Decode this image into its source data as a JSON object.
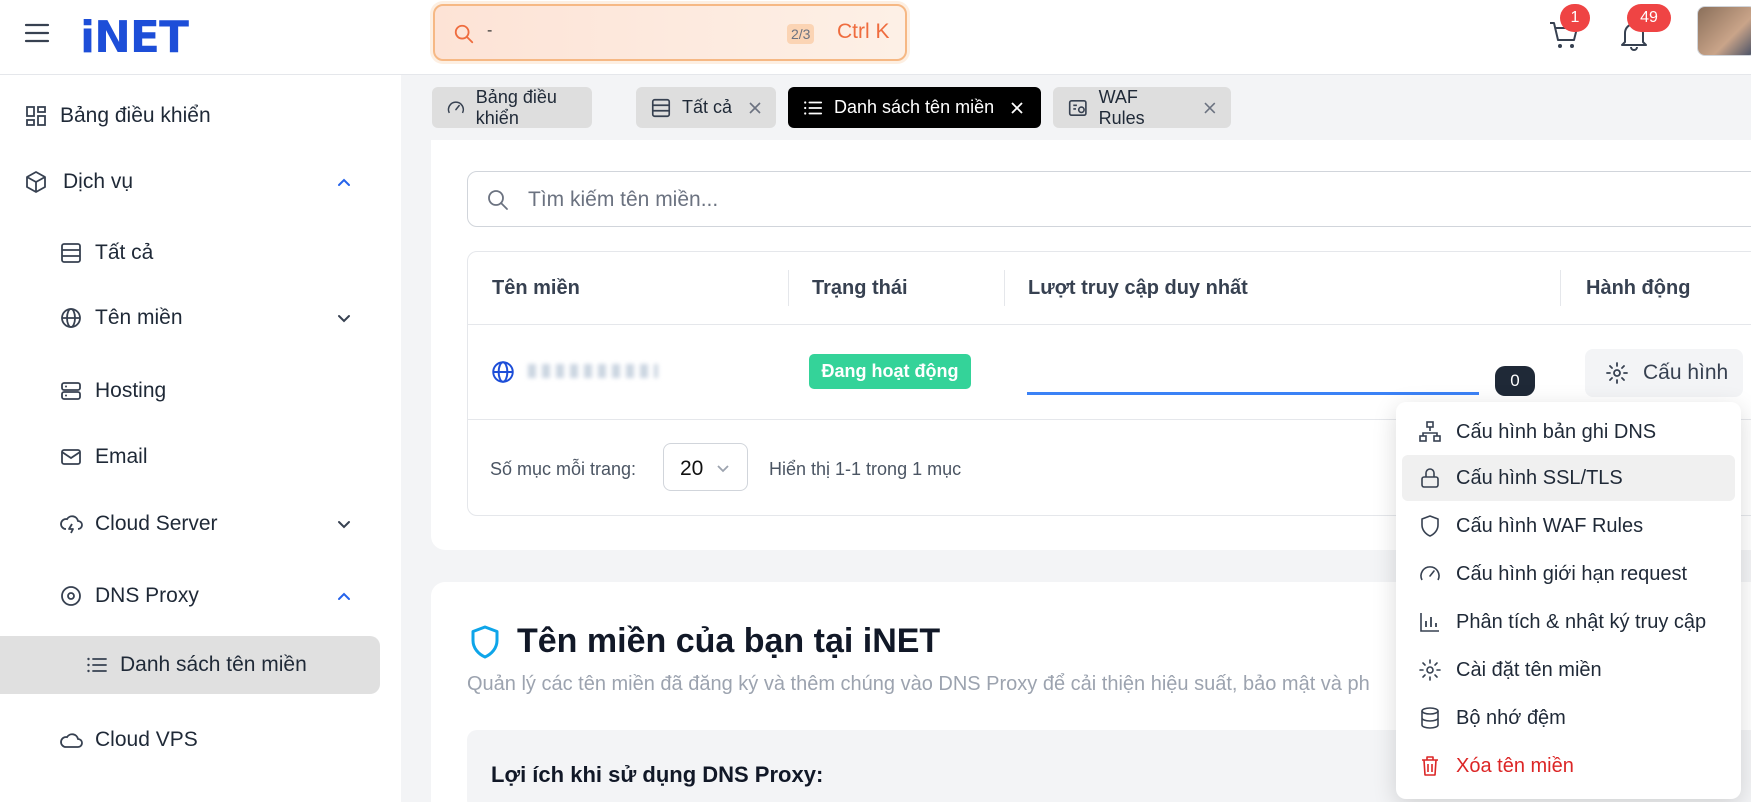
{
  "header": {
    "logo": "iNET",
    "search": {
      "counter": "2/3",
      "shortcut": "Ctrl K"
    },
    "cart_count": "1",
    "notif_count": "49"
  },
  "sidebar": {
    "items": [
      {
        "label": "Bảng điều khiển"
      },
      {
        "label": "Dịch vụ"
      },
      {
        "label": "Tất cả"
      },
      {
        "label": "Tên miền"
      },
      {
        "label": "Hosting"
      },
      {
        "label": "Email"
      },
      {
        "label": "Cloud Server"
      },
      {
        "label": "DNS Proxy"
      },
      {
        "label": "Danh sách tên miền"
      },
      {
        "label": "Cloud VPS"
      }
    ]
  },
  "tabs": [
    {
      "label": "Bảng điều khiển"
    },
    {
      "label": "Tất cả"
    },
    {
      "label": "Danh sách tên miền"
    },
    {
      "label": "WAF Rules"
    }
  ],
  "main": {
    "search_placeholder": "Tìm kiếm tên miền...",
    "columns": [
      "Tên miền",
      "Trạng thái",
      "Lượt truy cập duy nhất",
      "Hành động"
    ],
    "row": {
      "status": "Đang hoạt động",
      "visits": "0",
      "action": "Cấu hình"
    },
    "pagination": {
      "label": "Số mục mỗi trang:",
      "per_page": "20",
      "info": "Hiển thị 1-1 trong 1 mục"
    },
    "section": {
      "title": "Tên miền của bạn tại iNET",
      "subtitle": "Quản lý các tên miền đã đăng ký và thêm chúng vào DNS Proxy để cải thiện hiệu suất, bảo mật và ph",
      "benefit_title": "Lợi ích khi sử dụng DNS Proxy:"
    }
  },
  "menu": {
    "items": [
      {
        "label": "Cấu hình bản ghi DNS",
        "icon": "sitemap-icon"
      },
      {
        "label": "Cấu hình SSL/TLS",
        "icon": "lock-icon"
      },
      {
        "label": "Cấu hình WAF Rules",
        "icon": "shield-icon"
      },
      {
        "label": "Cấu hình giới hạn request",
        "icon": "gauge-icon"
      },
      {
        "label": "Phân tích & nhật ký truy cập",
        "icon": "bar-chart-icon"
      },
      {
        "label": "Cài đặt tên miền",
        "icon": "gear-icon"
      },
      {
        "label": "Bộ nhớ đệm",
        "icon": "database-icon"
      },
      {
        "label": "Xóa tên miền",
        "icon": "trash-icon"
      }
    ]
  },
  "colors": {
    "brand": "#1d4ed8",
    "status_active": "#34d399",
    "danger": "#dc2626",
    "accent_search": "#f6b884"
  }
}
